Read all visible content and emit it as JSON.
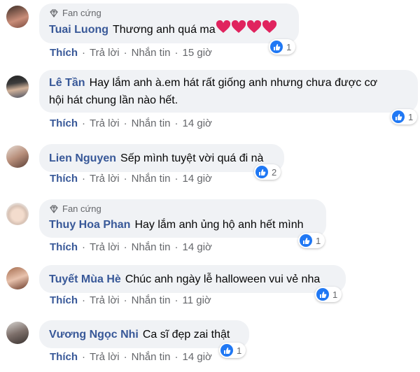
{
  "labels": {
    "fan": "Fan cứng",
    "like": "Thích",
    "reply": "Trả lời",
    "message": "Nhắn tin",
    "dot": "·"
  },
  "colors": {
    "name": "#385898",
    "bubble": "#f0f2f5",
    "like_blue": "#2078f4",
    "heart": "#e0245e"
  },
  "comments": [
    {
      "name": "Tuai Luong",
      "text": "Thương anh quá ma",
      "time": "15 giờ",
      "likes": "1",
      "fan": true,
      "emoji": "heart-icon x4"
    },
    {
      "name": "Lê Tần",
      "text": "Hay lắm anh à.em hát rất giống anh nhưng chưa được cơ",
      "text2": "hội hát chung lần nào hết.",
      "time": "14 giờ",
      "likes": "1",
      "fan": false
    },
    {
      "name": "Lien Nguyen",
      "text": "Sếp mình tuyệt vời quá đi nà",
      "time": "14 giờ",
      "likes": "2",
      "fan": false
    },
    {
      "name": "Thuy Hoa Phan",
      "text": "Hay lắm anh ủng hộ anh hết mình",
      "time": "14 giờ",
      "likes": "1",
      "fan": true
    },
    {
      "name": "Tuyết Mùa Hè",
      "text": "Chúc anh ngày lễ halloween vui vẻ nha",
      "time": "11 giờ",
      "likes": "1",
      "fan": false
    },
    {
      "name": "Vương Ngọc Nhi",
      "text": "Ca sĩ đẹp zai thật",
      "time": "14 giờ",
      "likes": "1",
      "fan": false
    }
  ]
}
